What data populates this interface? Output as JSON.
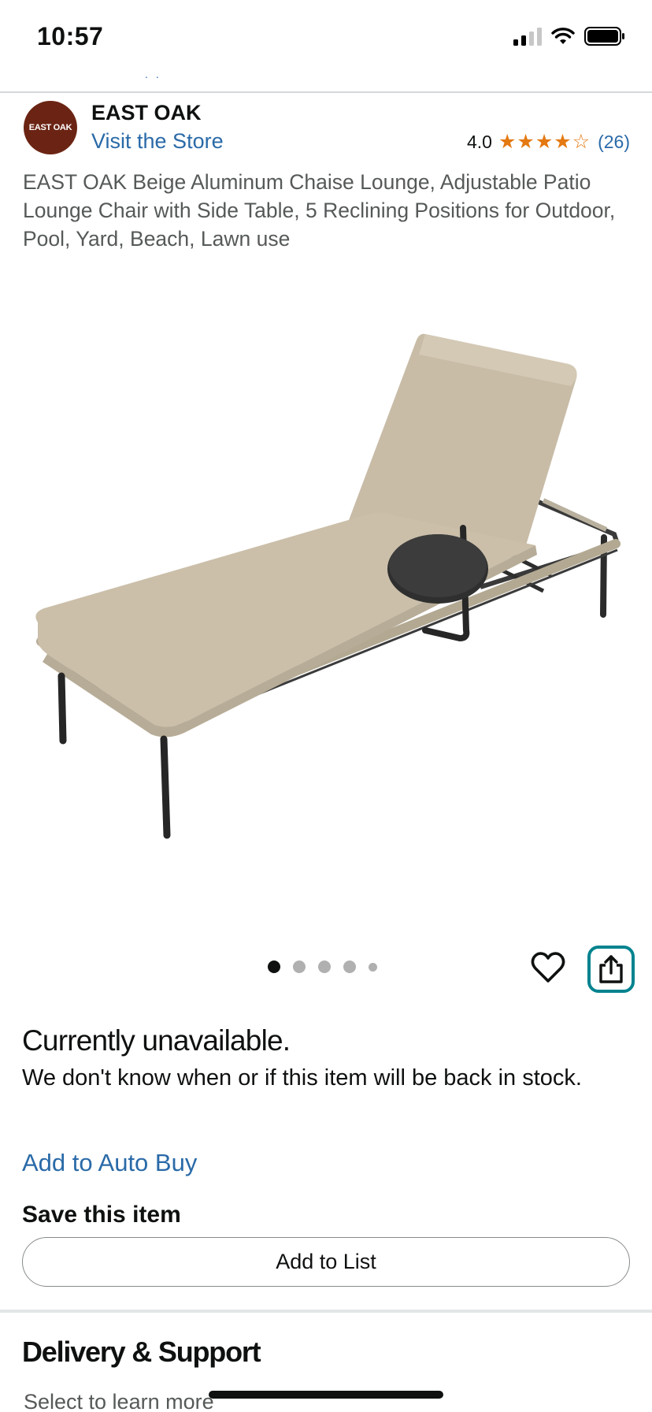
{
  "status_bar": {
    "time": "10:57",
    "icons": [
      "signal-icon",
      "wifi-icon",
      "battery-icon"
    ]
  },
  "brand": {
    "logo_text": "EAST OAK",
    "name": "EAST OAK",
    "visit_store": "Visit the Store"
  },
  "rating": {
    "value": "4.0",
    "stars": 4,
    "count": "(26)",
    "star_color": "#e47911"
  },
  "product": {
    "title": "EAST OAK Beige Aluminum Chaise Lounge, Adjustable Patio Lounge Chair with Side Table, 5 Reclining Positions for Outdoor, Pool, Yard, Beach, Lawn use",
    "image_dots": 5,
    "active_dot": 1
  },
  "actions": {
    "wishlist_icon": "heart-icon",
    "share_icon": "share-icon",
    "share_accent": "#00838f"
  },
  "availability": {
    "title": "Currently unavailable.",
    "message": "We don't know when or if this item will be back in stock."
  },
  "auto_buy": {
    "label": "Add to Auto Buy"
  },
  "save": {
    "heading": "Save this item",
    "button_label": "Add to List"
  },
  "delivery": {
    "heading": "Delivery & Support",
    "subtitle": "Select to learn more"
  },
  "colors": {
    "link": "#2a6aa8",
    "text": "#0f1111",
    "muted": "#565959"
  }
}
